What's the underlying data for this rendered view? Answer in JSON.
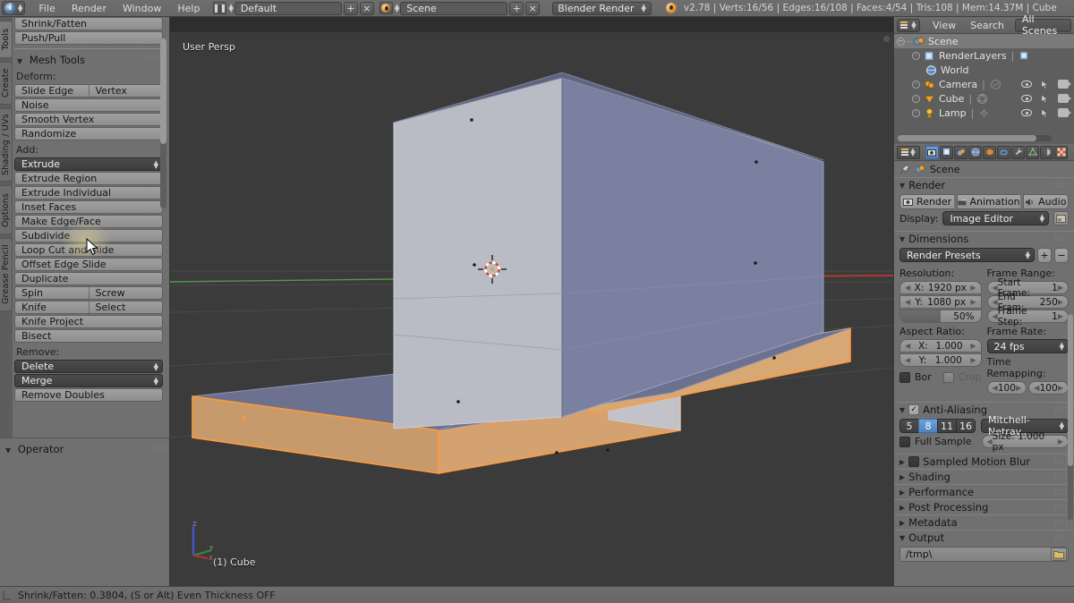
{
  "topbar": {
    "app_icon": "blender-logo-icon",
    "menus": [
      "File",
      "Render",
      "Window",
      "Help"
    ],
    "screen_layout": "Default",
    "scene_name": "Scene",
    "render_engine": "Blender Render",
    "add_label": "+",
    "close_label": "×",
    "stats": "v2.78 | Verts:16/56 | Edges:16/108 | Faces:4/54 | Tris:108 | Mem:14.37M | Cube"
  },
  "toolshelf": {
    "tabs": [
      {
        "label": "Tools",
        "active": true
      },
      {
        "label": "Create",
        "active": false
      },
      {
        "label": "Shading / UVs",
        "active": false
      },
      {
        "label": "Options",
        "active": false
      },
      {
        "label": "Grease Pencil",
        "active": false
      }
    ],
    "top_buttons": [
      "Shrink/Fatten",
      "Push/Pull"
    ],
    "mesh_tools": {
      "title": "Mesh Tools",
      "deform_label": "Deform:",
      "deform_split": [
        "Slide Edge",
        "Vertex"
      ],
      "deform_items": [
        "Noise",
        "Smooth Vertex",
        "Randomize"
      ],
      "add_label": "Add:",
      "add_dropdown": "Extrude",
      "add_items": [
        "Extrude Region",
        "Extrude Individual",
        "Inset Faces",
        "Make Edge/Face",
        "Subdivide",
        "Loop Cut and Slide",
        "Offset Edge Slide",
        "Duplicate"
      ],
      "spin_split": [
        "Spin",
        "Screw"
      ],
      "knife_split": [
        "Knife",
        "Select"
      ],
      "add_items_tail": [
        "Knife Project",
        "Bisect"
      ],
      "remove_label": "Remove:",
      "remove_dropdowns": [
        "Delete",
        "Merge"
      ],
      "remove_items": [
        "Remove Doubles"
      ]
    },
    "operator_panel": {
      "title": "Operator"
    }
  },
  "viewport": {
    "view_label": "User Persp",
    "object_label": "(1) Cube",
    "background_color": "#3b3b3b",
    "selected_edge_color": "#ff9b3a",
    "axis_labels": [
      "X",
      "Y",
      "Z"
    ]
  },
  "outliner": {
    "menus": [
      "View",
      "Search"
    ],
    "scope": "All Scenes",
    "rows": [
      {
        "label": "Scene",
        "icon": "scene-icon",
        "depth": 0,
        "selected": true,
        "expandable": true,
        "has_controls": false
      },
      {
        "label": "RenderLayers",
        "icon": "renderlayers-icon",
        "depth": 1,
        "selected": false,
        "expandable": true,
        "has_controls": false
      },
      {
        "label": "World",
        "icon": "world-icon",
        "depth": 1,
        "selected": false,
        "expandable": false,
        "has_controls": false
      },
      {
        "label": "Camera",
        "icon": "camera-icon",
        "depth": 1,
        "selected": false,
        "expandable": true,
        "has_controls": true
      },
      {
        "label": "Cube",
        "icon": "mesh-icon",
        "depth": 1,
        "selected": false,
        "expandable": true,
        "has_controls": true
      },
      {
        "label": "Lamp",
        "icon": "lamp-icon",
        "depth": 1,
        "selected": false,
        "expandable": true,
        "has_controls": true
      }
    ]
  },
  "properties": {
    "tabs": [
      {
        "name": "render-tab",
        "glyph": "📷",
        "active": true
      },
      {
        "name": "render-layers-tab",
        "glyph": "▤",
        "active": false
      },
      {
        "name": "scene-tab",
        "glyph": "♪",
        "active": false
      },
      {
        "name": "world-tab",
        "glyph": "●",
        "active": false
      },
      {
        "name": "object-tab",
        "glyph": "■",
        "active": false
      },
      {
        "name": "constraints-tab",
        "glyph": "⚭",
        "active": false
      },
      {
        "name": "modifiers-tab",
        "glyph": "🔧",
        "active": false
      },
      {
        "name": "data-tab",
        "glyph": "▽",
        "active": false
      },
      {
        "name": "material-tab",
        "glyph": "◐",
        "active": false
      },
      {
        "name": "texture-tab",
        "glyph": "▓",
        "active": false
      }
    ],
    "breadcrumb": "Scene",
    "render": {
      "title": "Render",
      "render_button": "Render",
      "animation_button": "Animation",
      "audio_button": "Audio",
      "display_label": "Display:",
      "display_value": "Image Editor"
    },
    "dimensions": {
      "title": "Dimensions",
      "presets": "Render Presets",
      "resolution_label": "Resolution:",
      "res_x_name": "X:",
      "res_x_value": "1920 px",
      "res_y_name": "Y:",
      "res_y_value": "1080 px",
      "res_percent": "50%",
      "aspect_label": "Aspect Ratio:",
      "asp_x_name": "X:",
      "asp_x_value": "1.000",
      "asp_y_name": "Y:",
      "asp_y_value": "1.000",
      "border_label": "Bor",
      "crop_label": "Crop",
      "frame_range_label": "Frame Range:",
      "start_frame_name": "Start Frame:",
      "start_frame_value": "1",
      "end_frame_name": "End Fram:",
      "end_frame_value": "250",
      "frame_step_name": "Frame Step:",
      "frame_step_value": "1",
      "frame_rate_label": "Frame Rate:",
      "frame_rate_value": "24 fps",
      "time_remap_label": "Time Remapping:",
      "time_remap_old": "100",
      "time_remap_new": "100"
    },
    "antialiasing": {
      "title": "Anti-Aliasing",
      "enabled": true,
      "samples": [
        "5",
        "8",
        "11",
        "16"
      ],
      "active_sample": "8",
      "filter_value": "Mitchell-Netrav...",
      "full_sample_label": "Full Sample",
      "size_label": "Size: 1.000 px"
    },
    "collapsed_sections": [
      {
        "title": "Sampled Motion Blur",
        "has_checkbox": true
      },
      {
        "title": "Shading",
        "has_checkbox": false
      },
      {
        "title": "Performance",
        "has_checkbox": false
      },
      {
        "title": "Post Processing",
        "has_checkbox": false
      },
      {
        "title": "Metadata",
        "has_checkbox": false
      }
    ],
    "output": {
      "title": "Output",
      "path": "/tmp\\"
    }
  },
  "statusbar": {
    "message": "Shrink/Fatten: 0.3804, (S or Alt) Even Thickness OFF"
  }
}
